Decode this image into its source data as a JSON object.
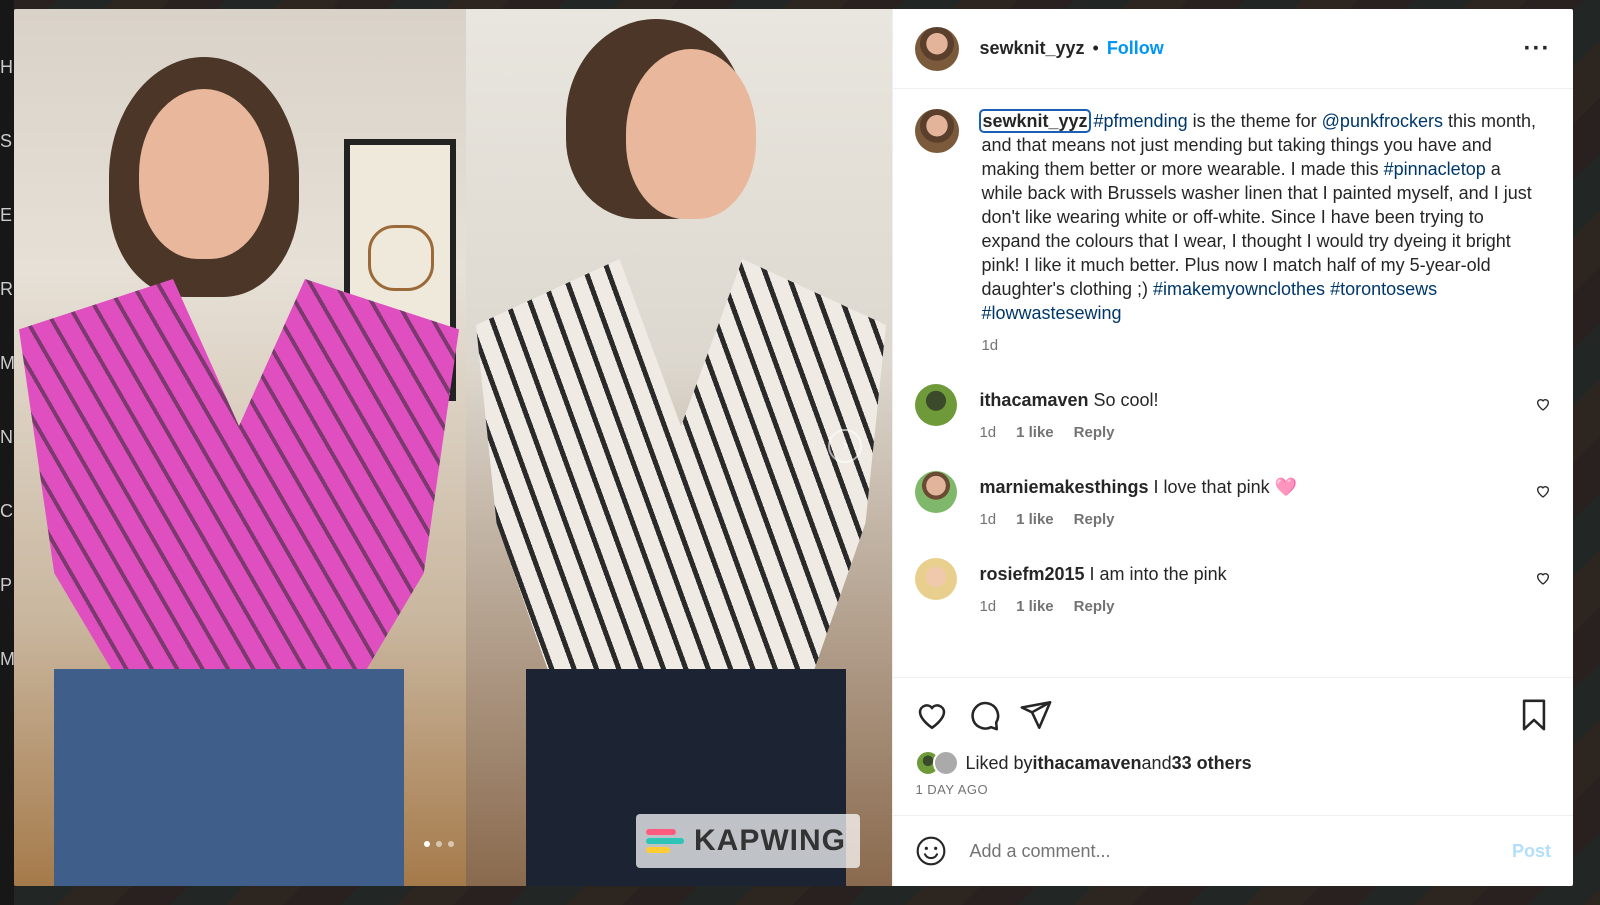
{
  "post": {
    "username": "sewknit_yyz",
    "separator": "•",
    "follow_label": "Follow",
    "more_icon": "more-horizontal-icon"
  },
  "caption": {
    "username": "sewknit_yyz",
    "tag1": "#pfmending",
    "text1": " is the theme for ",
    "mention": "@punkfrockers",
    "text2": " this month, and that means not just mending but taking things you have and making them better or more wearable. I made this ",
    "tag2": "#pinnacletop",
    "text3": " a while back with Brussels washer linen that I painted myself, and I just don't like wearing white or off-white. Since I have been trying to expand the colours that I wear, I thought I would try dyeing it bright pink! I like it much better. Plus now I match half of my 5-year-old daughter's clothing ;) ",
    "tag3": "#imakemyownclothes",
    "tag4": "#torontosews",
    "tag5": "#lowwastesewing",
    "time": "1d"
  },
  "comments": [
    {
      "user": "ithacamaven",
      "text": "So cool!",
      "time": "1d",
      "likes": "1 like",
      "reply": "Reply"
    },
    {
      "user": "marniemakesthings",
      "text": "I love that pink 🩷",
      "time": "1d",
      "likes": "1 like",
      "reply": "Reply"
    },
    {
      "user": "rosiefm2015",
      "text": "I am into the pink",
      "time": "1d",
      "likes": "1 like",
      "reply": "Reply"
    }
  ],
  "likes": {
    "prefix": "Liked by ",
    "user": "ithacamaven",
    "and": " and ",
    "others": "33 others",
    "ago": "1 DAY AGO"
  },
  "add_comment": {
    "placeholder": "Add a comment...",
    "post_label": "Post"
  },
  "media": {
    "watermark": "KAPWING",
    "carousel_index": 1,
    "carousel_count": 3
  },
  "background_letters": [
    "H",
    "S",
    "E",
    "R",
    "M",
    "N",
    "C",
    "P",
    "M"
  ],
  "colors": {
    "link": "#00376b",
    "follow": "#0095f6",
    "post_disabled": "#b2dffc",
    "shirt_pink": "#e04fc0"
  }
}
